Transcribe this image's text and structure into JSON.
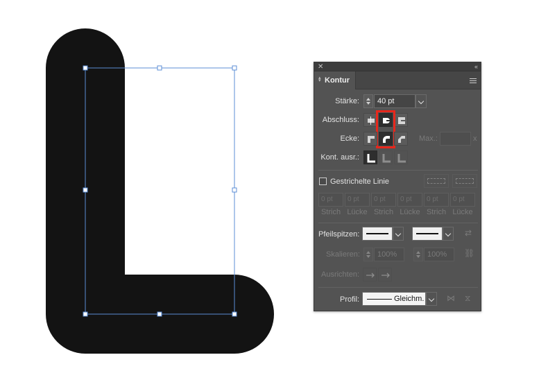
{
  "panel": {
    "title": "Kontur",
    "close_icon": "close-icon",
    "collapse_icon": "collapse-icon",
    "menu_icon": "panel-menu-icon"
  },
  "stroke": {
    "weight_label": "Stärke:",
    "weight_value": "40 pt",
    "cap_label": "Abschluss:",
    "cap_options": [
      "butt-cap",
      "round-cap",
      "projecting-cap"
    ],
    "cap_selected": "round-cap",
    "corner_label": "Ecke:",
    "corner_options": [
      "miter-join",
      "round-join",
      "bevel-join"
    ],
    "corner_selected": "round-join",
    "limit_label": "Max.:",
    "limit_unit": "x",
    "align_label": "Kont. ausr.:",
    "align_options": [
      "align-center",
      "align-inside",
      "align-outside"
    ]
  },
  "dashed": {
    "checkbox_label": "Gestrichelte Linie",
    "checked": false,
    "fields": [
      {
        "value": "0 pt",
        "label": "Strich"
      },
      {
        "value": "0 pt",
        "label": "Lücke"
      },
      {
        "value": "0 pt",
        "label": "Strich"
      },
      {
        "value": "0 pt",
        "label": "Lücke"
      },
      {
        "value": "0 pt",
        "label": "Strich"
      },
      {
        "value": "0 pt",
        "label": "Lücke"
      }
    ]
  },
  "arrows": {
    "label": "Pfeilspitzen:",
    "scale_label": "Skalieren:",
    "scale_start": "100%",
    "scale_end": "100%",
    "align_label": "Ausrichten:"
  },
  "profile": {
    "label": "Profil:",
    "value": "Gleichm."
  },
  "colors": {
    "panel_bg": "#535353",
    "highlight": "#e8261b",
    "selection": "#5b8ed6",
    "shape_fill": "#131313"
  }
}
